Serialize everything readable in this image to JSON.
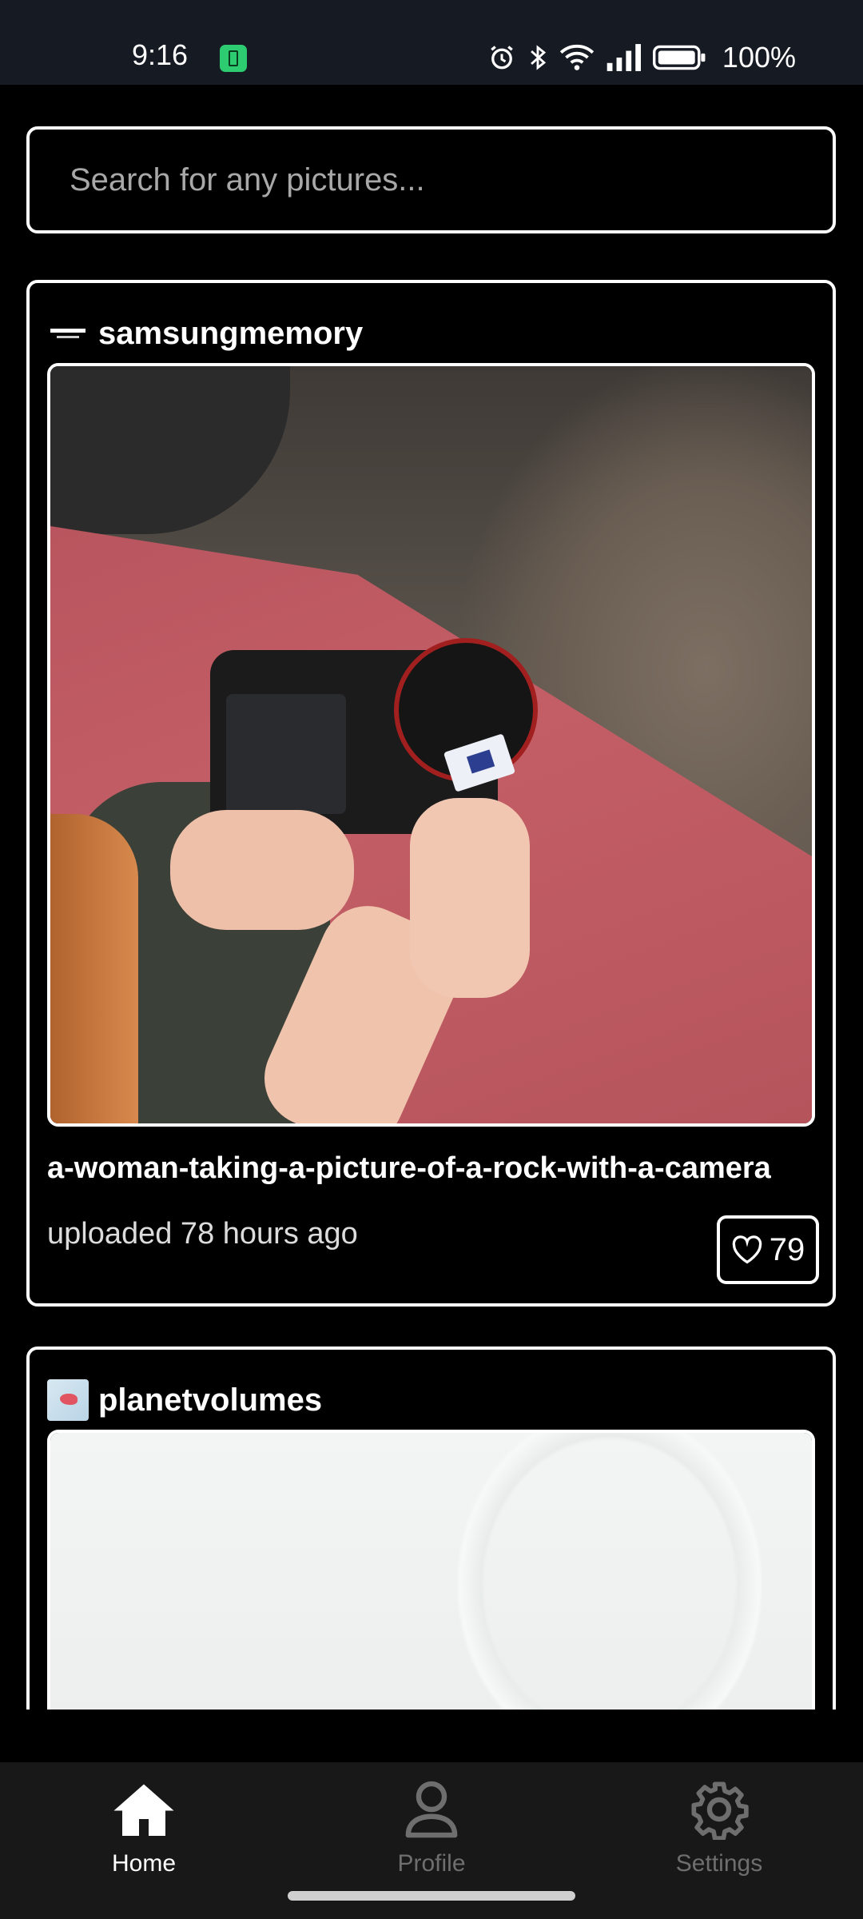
{
  "status_bar": {
    "time": "9:16",
    "battery_percent": "100%",
    "icons": [
      "battery-saver-icon",
      "alarm-icon",
      "bluetooth-icon",
      "wifi-icon",
      "signal-icon",
      "battery-icon"
    ]
  },
  "search": {
    "placeholder": "Search for any pictures...",
    "value": ""
  },
  "feed": [
    {
      "username": "samsungmemory",
      "caption": "a-woman-taking-a-picture-of-a-rock-with-a-camera",
      "uploaded": "uploaded 78 hours ago",
      "likes": "79"
    },
    {
      "username": "planetvolumes"
    }
  ],
  "nav": {
    "active": "Home",
    "items": [
      {
        "label": "Home",
        "icon": "home-icon"
      },
      {
        "label": "Profile",
        "icon": "person-icon"
      },
      {
        "label": "Settings",
        "icon": "gear-icon"
      }
    ]
  },
  "colors": {
    "background": "#000000",
    "status_bar": "#161a22",
    "nav_bar": "#181818",
    "active_nav": "#ffffff",
    "inactive_nav": "#6e6e6e",
    "border": "#ffffff"
  }
}
